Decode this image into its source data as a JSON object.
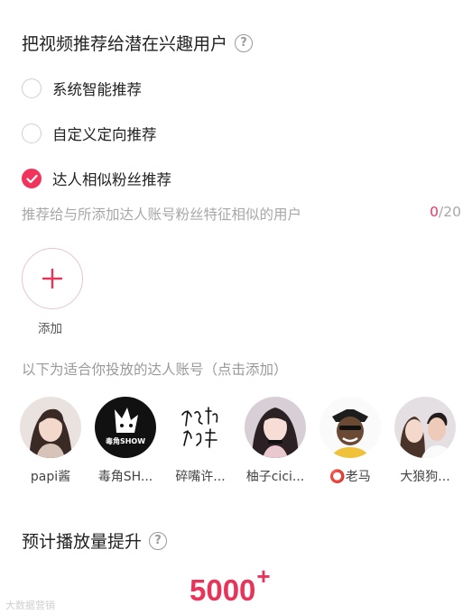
{
  "recommend": {
    "title": "把视频推荐给潜在兴趣用户",
    "help_icon": "question-icon",
    "options": [
      {
        "label": "系统智能推荐",
        "checked": false
      },
      {
        "label": "自定义定向推荐",
        "checked": false
      },
      {
        "label": "达人相似粉丝推荐",
        "checked": true
      }
    ],
    "hint": "推荐给与所添加达人账号粉丝特征相似的用户",
    "count_current": "0",
    "count_total": "/20",
    "add_label": "添加"
  },
  "suggestions": {
    "title": "以下为适合你投放的达人账号（点击添加）",
    "items": [
      {
        "name": "papi酱"
      },
      {
        "name": "毒角SH..."
      },
      {
        "name": "碎嘴许..."
      },
      {
        "name": "柚子cici..."
      },
      {
        "name": "⭕老马"
      },
      {
        "name": "大狼狗..."
      }
    ]
  },
  "estimate": {
    "title": "预计播放量提升",
    "value": "5000",
    "suffix": "+"
  },
  "watermark": "大数据营销",
  "colors": {
    "accent": "#f0345c"
  }
}
